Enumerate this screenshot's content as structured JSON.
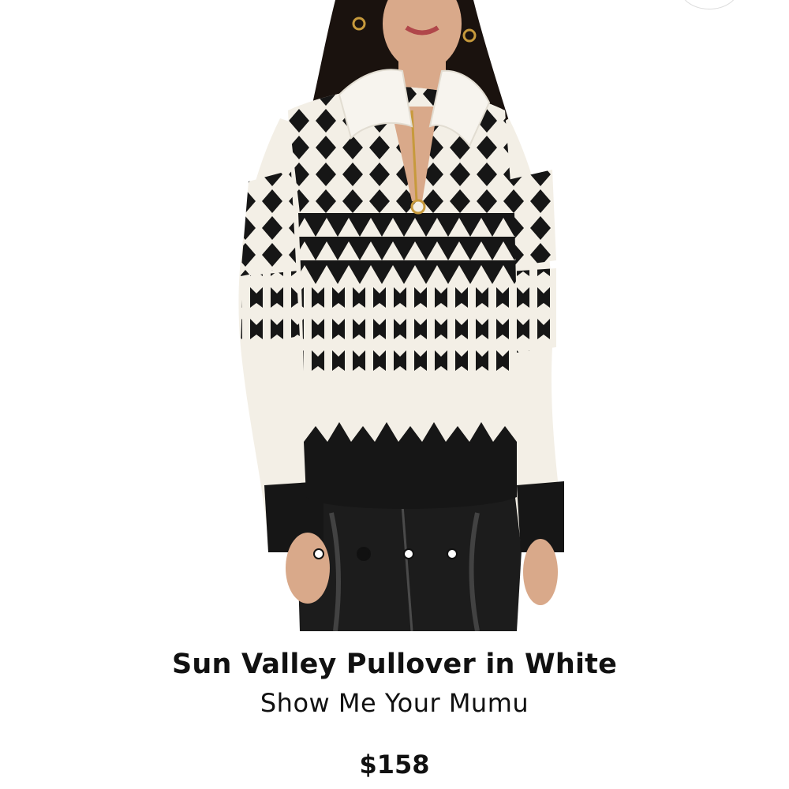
{
  "product": {
    "title": "Sun Valley Pullover in White",
    "brand": "Show Me Your Mumu",
    "price": "$158"
  },
  "carousel": {
    "dot_count": 4,
    "active_index": 1
  },
  "colors": {
    "text": "#111111",
    "sweater_black": "#161616",
    "sweater_white": "#f3efe6",
    "pants": "#1c1c1c",
    "skin": "#d9a98a",
    "hair": "#1a120e"
  }
}
